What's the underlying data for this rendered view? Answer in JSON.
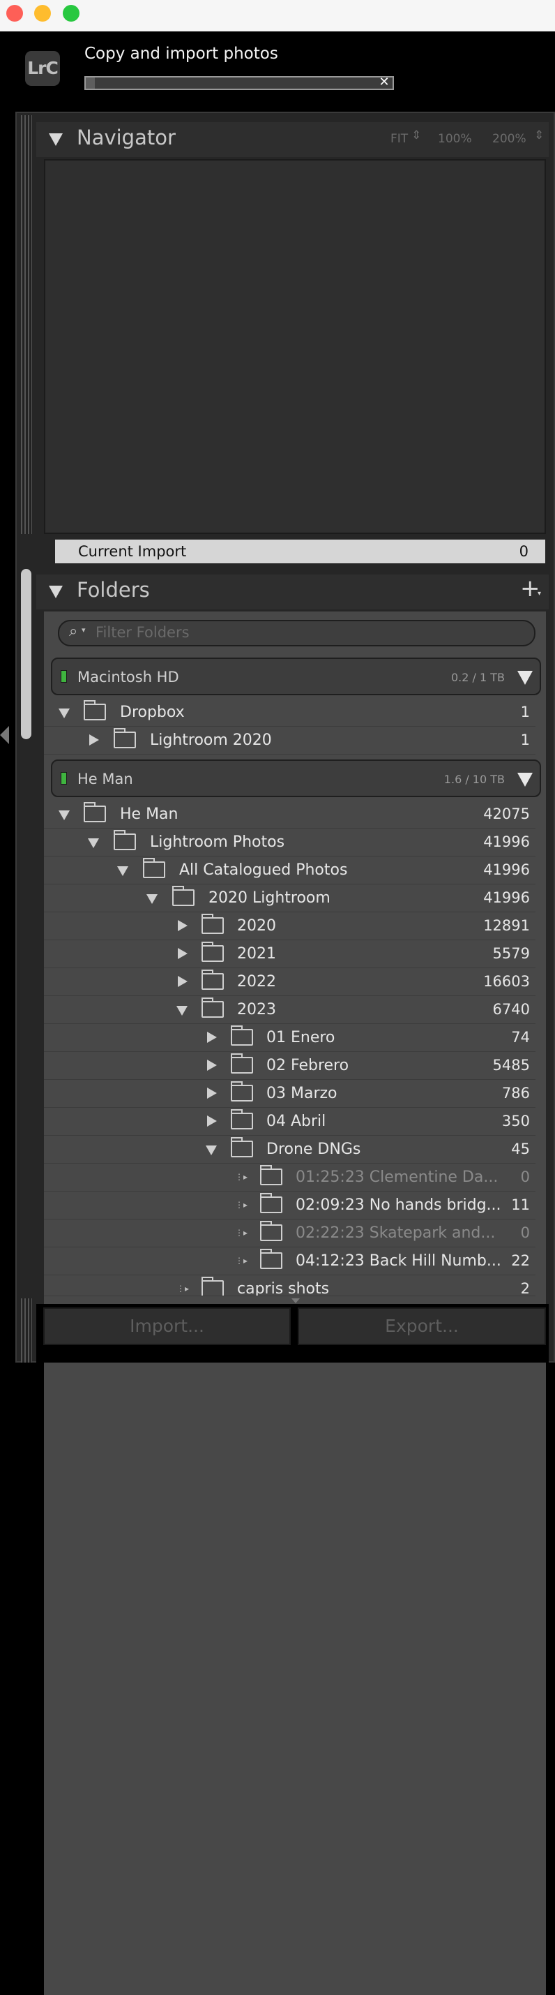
{
  "window": {
    "traffic_lights": [
      "close",
      "minimize",
      "zoom"
    ]
  },
  "import": {
    "logo": "LrC",
    "status": "Copy and import photos",
    "progress_fraction": 0.03,
    "cancel_icon": "close-icon"
  },
  "navigator": {
    "title": "Navigator",
    "zoom_options": [
      "FIT",
      "100%",
      "200%"
    ]
  },
  "catalog": {
    "current_import_label": "Current Import",
    "current_import_count": "0"
  },
  "folders": {
    "title": "Folders",
    "add_label": "+",
    "filter_placeholder": "Filter Folders",
    "volumes": [
      {
        "name": "Macintosh HD",
        "size": "0.2 / 1 TB",
        "rows": [
          {
            "name": "Dropbox",
            "count": "1",
            "expanded": true
          },
          {
            "name": "Lightroom 2020",
            "count": "1",
            "expanded": false
          }
        ]
      },
      {
        "name": "He Man",
        "size": "1.6 / 10 TB",
        "rows": [
          {
            "name": "He Man",
            "count": "42075",
            "expanded": true
          },
          {
            "name": "Lightroom Photos",
            "count": "41996",
            "expanded": true
          },
          {
            "name": "All Catalogued Photos",
            "count": "41996",
            "expanded": true
          },
          {
            "name": "2020 Lightroom",
            "count": "41996",
            "expanded": true
          },
          {
            "name": "2020",
            "count": "12891",
            "expanded": false
          },
          {
            "name": "2021",
            "count": "5579",
            "expanded": false
          },
          {
            "name": "2022",
            "count": "16603",
            "expanded": false
          },
          {
            "name": "2023",
            "count": "6740",
            "expanded": true
          },
          {
            "name": "01 Enero",
            "count": "74",
            "expanded": false
          },
          {
            "name": "02 Febrero",
            "count": "5485",
            "expanded": false
          },
          {
            "name": "03 Marzo",
            "count": "786",
            "expanded": false
          },
          {
            "name": "04 Abril",
            "count": "350",
            "expanded": false
          },
          {
            "name": "Drone DNGs",
            "count": "45",
            "expanded": true
          },
          {
            "name": "01:25:23 Clementine Da...",
            "count": "0",
            "dim": true
          },
          {
            "name": "02:09:23 No hands bridg...",
            "count": "11"
          },
          {
            "name": "02:22:23 Skatepark and...",
            "count": "0",
            "dim": true
          },
          {
            "name": "04:12:23 Back Hill Numb...",
            "count": "22"
          },
          {
            "name": "capris shots",
            "count": "2"
          }
        ]
      }
    ]
  },
  "buttons": {
    "import": "Import...",
    "export": "Export..."
  }
}
